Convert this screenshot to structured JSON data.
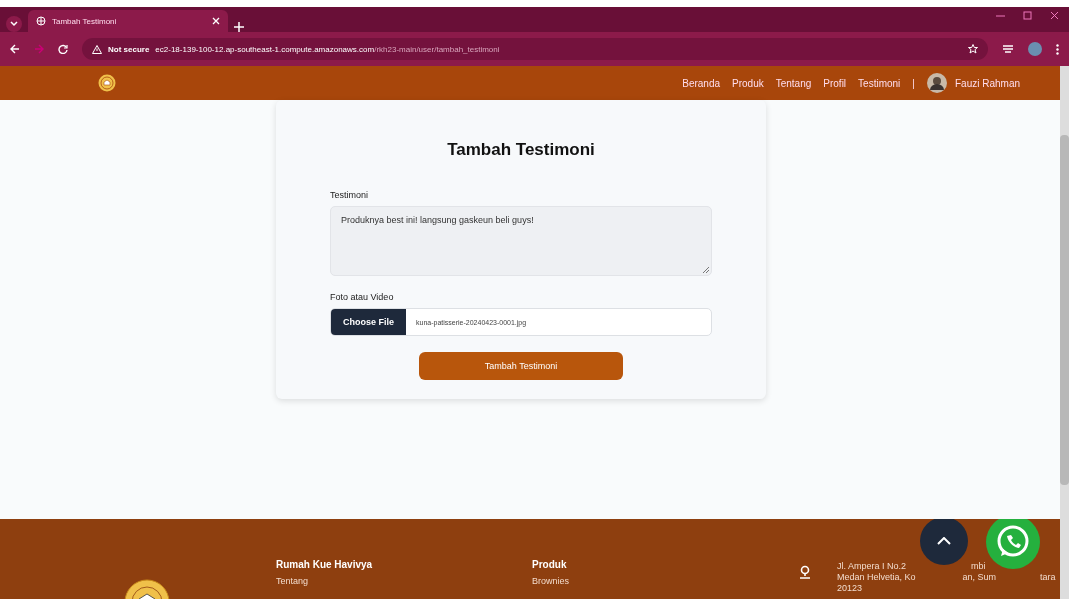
{
  "browser": {
    "tabs": [
      {
        "title": "Tambah Testimoni",
        "selected": true
      }
    ],
    "security": "Not secure",
    "url_host": "ec2-18-139-100-12.ap-southeast-1.compute.amazonaws.com",
    "url_path": "/rkh23-main/user/tambah_testimoni"
  },
  "nav": {
    "links": [
      {
        "label": "Beranda"
      },
      {
        "label": "Produk"
      },
      {
        "label": "Tentang"
      },
      {
        "label": "Profil"
      },
      {
        "label": "Testimoni"
      }
    ],
    "separator": "|",
    "user": "Fauzi Rahman"
  },
  "form": {
    "title": "Tambah Testimoni",
    "fields": [
      {
        "kind": "textarea",
        "label": "Testimoni",
        "value": "Produknya best ini! langsung gaskeun beli guys!"
      },
      {
        "kind": "file",
        "label": "Foto atau Video",
        "button": "Choose File",
        "value": "kuna-patisserie-20240423-0001.jpg"
      }
    ],
    "submit": "Tambah Testimoni"
  },
  "footer": {
    "brand": "Rumah Kue Havivya",
    "brand_links": [
      "Tentang"
    ],
    "product_heading": "Produk",
    "product_links": [
      "Brownies"
    ],
    "address_lines": [
      [
        "Jl. Ampera I No.2",
        "mbi"
      ],
      [
        "Medan Helvetia, Ko",
        "an, Sum",
        "tara"
      ],
      [
        "20123"
      ]
    ]
  }
}
